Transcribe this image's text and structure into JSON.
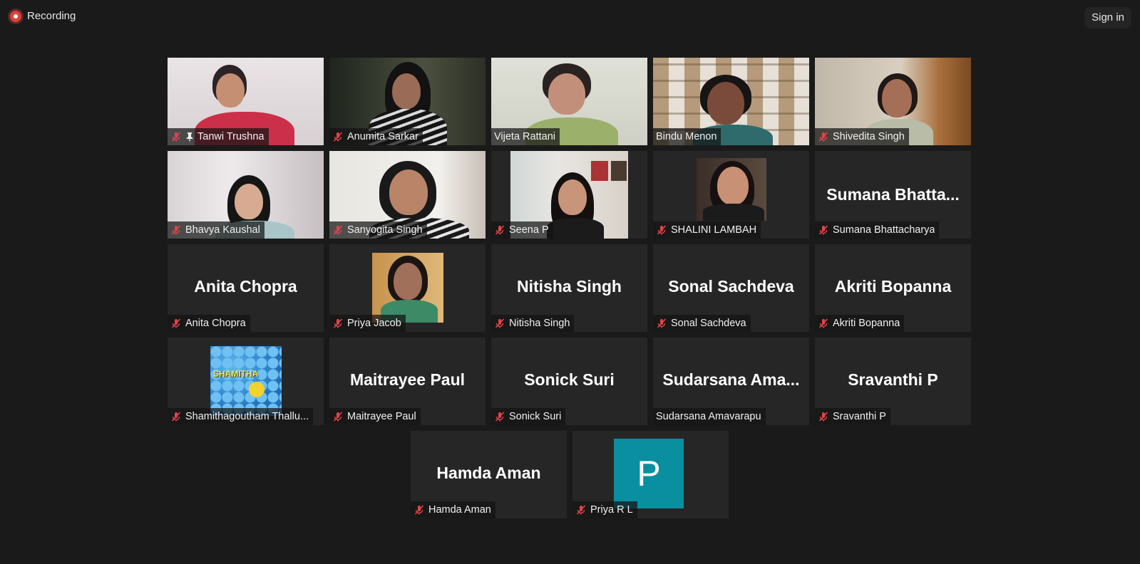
{
  "topbar": {
    "recording_label": "Recording",
    "sign_in_label": "Sign in"
  },
  "participants": [
    {
      "label": "Tanwi Trushna",
      "pinned": true,
      "muted": true
    },
    {
      "label": "Anumita Sarkar",
      "muted": true
    },
    {
      "label": "Vijeta Rattani",
      "muted": false,
      "active_speaker": true
    },
    {
      "label": "Bindu Menon",
      "muted": false
    },
    {
      "label": "Shivedita Singh",
      "muted": true
    },
    {
      "label": "Bhavya Kaushal",
      "muted": true
    },
    {
      "label": "Sanyogita Singh",
      "muted": true
    },
    {
      "label": "Seena P",
      "muted": true
    },
    {
      "label": "SHALINI LAMBAH",
      "muted": true
    },
    {
      "display_name": "Sumana  Bhatta...",
      "label": "Sumana Bhattacharya",
      "muted": true
    },
    {
      "display_name": "Anita Chopra",
      "label": "Anita Chopra",
      "muted": true
    },
    {
      "label": "Priya Jacob",
      "muted": true
    },
    {
      "display_name": "Nitisha Singh",
      "label": "Nitisha Singh",
      "muted": true
    },
    {
      "display_name": "Sonal Sachdeva",
      "label": "Sonal Sachdeva",
      "muted": true
    },
    {
      "display_name": "Akriti Bopanna",
      "label": "Akriti Bopanna",
      "muted": true
    },
    {
      "label": "Shamithagoutham Thallu...",
      "avatar_text": "SHAMITHA",
      "muted": true
    },
    {
      "display_name": "Maitrayee Paul",
      "label": "Maitrayee Paul",
      "muted": true
    },
    {
      "display_name": "Sonick Suri",
      "label": "Sonick Suri",
      "muted": true
    },
    {
      "display_name": "Sudarsana  Ama...",
      "label": "Sudarsana Amavarapu",
      "muted": false
    },
    {
      "display_name": "Sravanthi P",
      "label": "Sravanthi P",
      "muted": true
    },
    {
      "display_name": "Hamda Aman",
      "label": "Hamda Aman",
      "muted": true
    },
    {
      "label": "Priya R L",
      "avatar_letter": "P",
      "muted": true
    }
  ],
  "colors": {
    "background": "#1a1a1a",
    "tile": "#262626",
    "active_speaker_border": "#b9dd4c",
    "muted_icon": "#e0454b",
    "recording": "#d9433a",
    "avatar_p": "#0a8fa0"
  },
  "icons": {
    "muted": "muted-mic-icon",
    "pin": "pin-icon",
    "recording": "recording-dot-icon"
  }
}
